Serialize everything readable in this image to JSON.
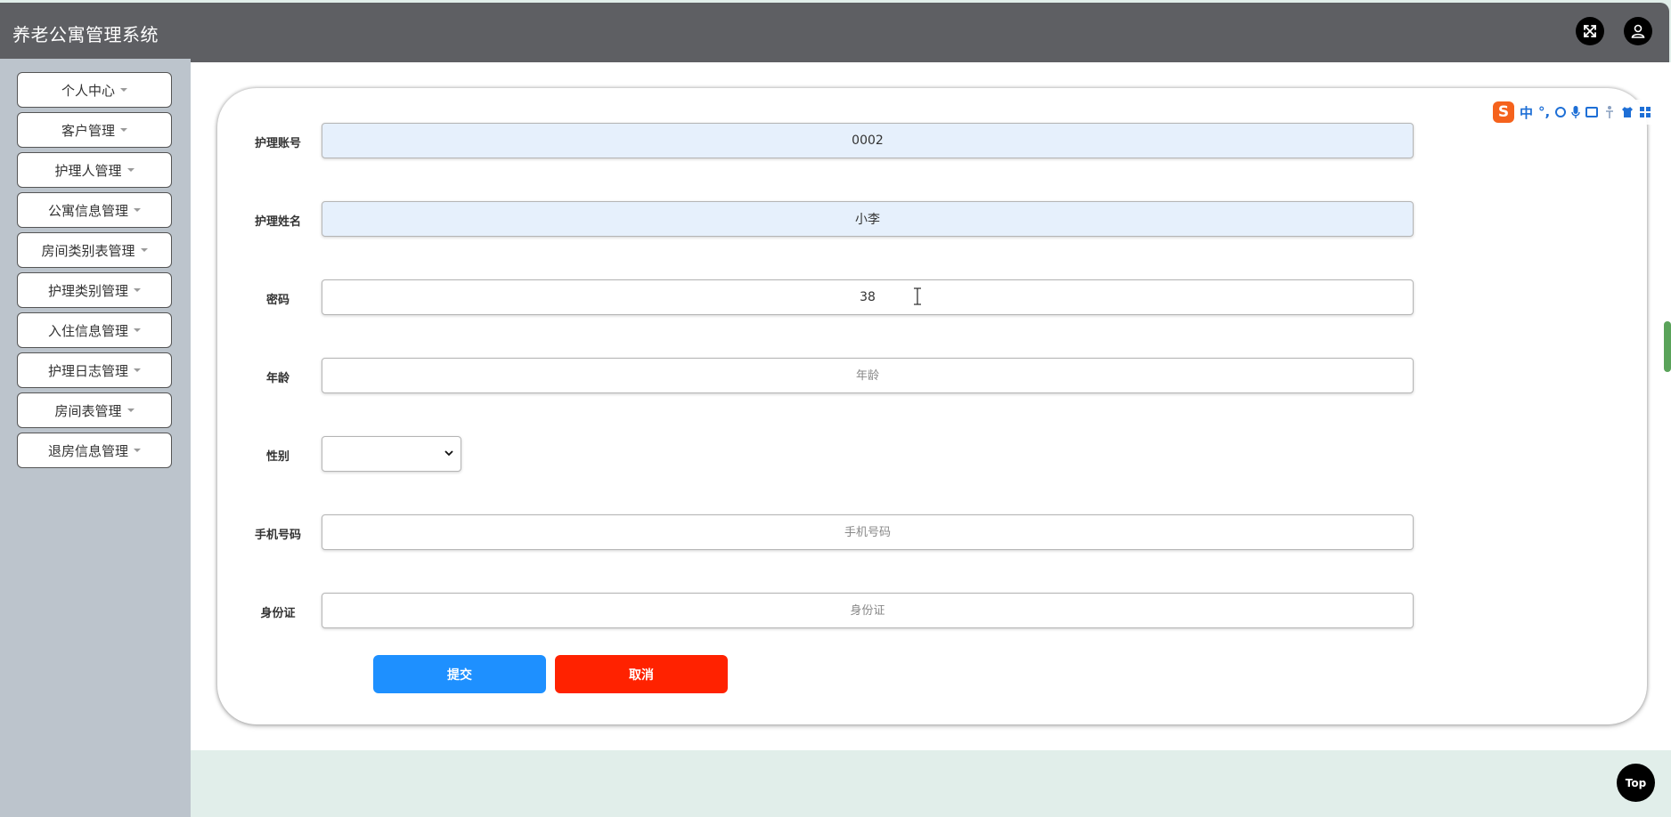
{
  "header": {
    "title": "养老公寓管理系统",
    "fullscreen_icon": "expand-icon",
    "user_icon": "user-icon"
  },
  "sidebar": {
    "items": [
      {
        "label": "个人中心"
      },
      {
        "label": "客户管理"
      },
      {
        "label": "护理人管理"
      },
      {
        "label": "公寓信息管理"
      },
      {
        "label": "房间类别表管理"
      },
      {
        "label": "护理类别管理"
      },
      {
        "label": "入住信息管理"
      },
      {
        "label": "护理日志管理"
      },
      {
        "label": "房间表管理"
      },
      {
        "label": "退房信息管理"
      }
    ]
  },
  "form": {
    "account": {
      "label": "护理账号",
      "value": "0002"
    },
    "name": {
      "label": "护理姓名",
      "value": "小李"
    },
    "password": {
      "label": "密码",
      "value": "38"
    },
    "age": {
      "label": "年龄",
      "value": "",
      "placeholder": "年龄"
    },
    "gender": {
      "label": "性别",
      "value": ""
    },
    "phone": {
      "label": "手机号码",
      "value": "",
      "placeholder": "手机号码"
    },
    "idcard": {
      "label": "身份证",
      "value": "",
      "placeholder": "身份证"
    },
    "submit_label": "提交",
    "cancel_label": "取消"
  },
  "ime": {
    "logo": "S",
    "mode": "中",
    "punct": "°,"
  },
  "top_button": "Top",
  "colors": {
    "header": "#5e5f63",
    "sidebar": "#bcc4cc",
    "submit": "#1e90ff",
    "cancel": "#ff2200",
    "readonly_field": "#e6f0fc"
  }
}
